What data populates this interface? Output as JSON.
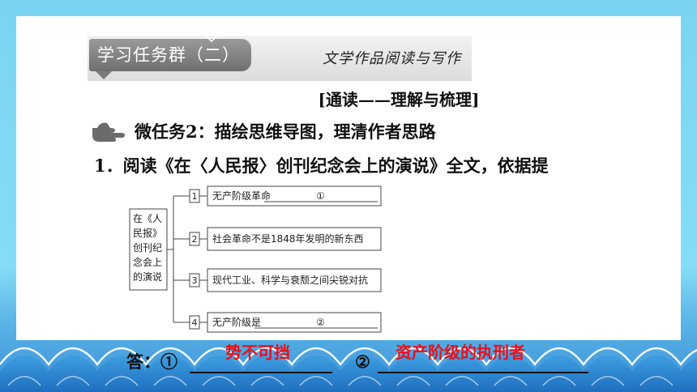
{
  "header": {
    "tab_label": "学习任务群（二）",
    "subtitle": "文学作品阅读与写作"
  },
  "section_title": "[通读——理解与梳理]",
  "task": {
    "icon": "pointing-hand-icon",
    "title": "微任务2：描绘思维导图，理清作者思路",
    "instruction": "1．阅读《在〈人民报〉创刊纪念会上的演说》全文，依据提"
  },
  "mindmap": {
    "root": [
      "在《人",
      "民报》",
      "创刊纪",
      "念会上",
      "的演说"
    ],
    "branches": [
      {
        "num": "1",
        "text": "无产阶级革命",
        "marker": "①"
      },
      {
        "num": "2",
        "text": "社会革命不是1848年发明的新东西",
        "marker": ""
      },
      {
        "num": "3",
        "text": "现代工业、科学与衰颓之间尖锐对抗",
        "marker": ""
      },
      {
        "num": "4",
        "text": "无产阶级是",
        "marker": "②"
      }
    ]
  },
  "answer": {
    "label": "答：①",
    "label2": "②",
    "answer1": "势不可挡",
    "answer2": "资产阶级的执刑者"
  },
  "colors": {
    "answer_red": "#e8101a",
    "header_gray": "#7f7f7f",
    "sky_blue": "#7ad4f1"
  }
}
